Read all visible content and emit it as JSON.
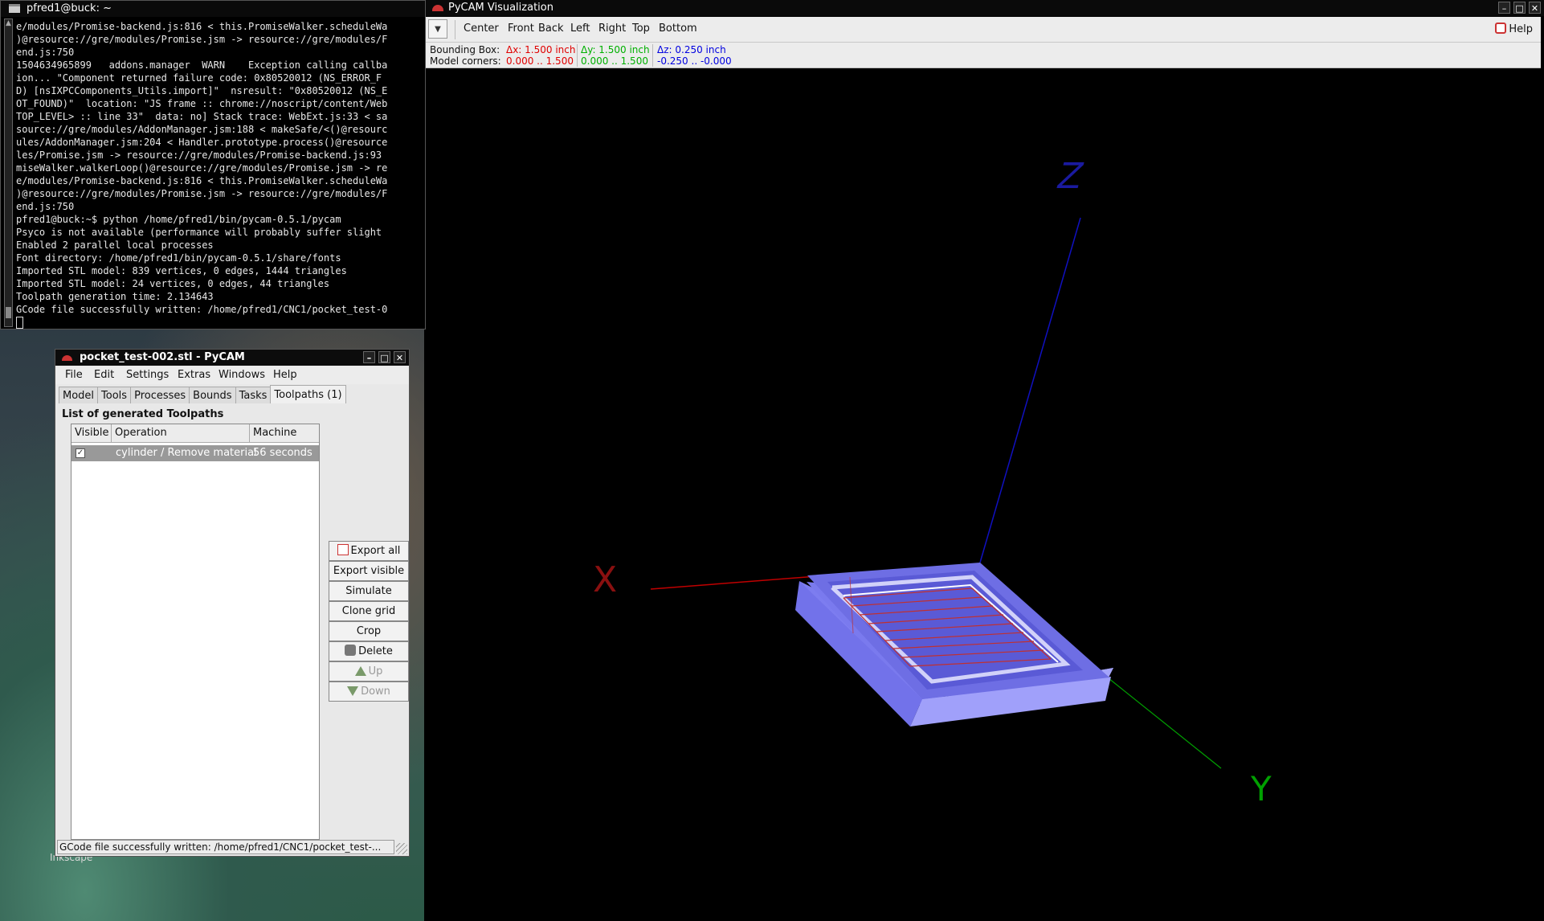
{
  "desktop": {
    "icon_label": "Inkscape"
  },
  "terminal": {
    "title": "pfred1@buck: ~",
    "lines": [
      "e/modules/Promise-backend.js:816 < this.PromiseWalker.scheduleWa",
      ")@resource://gre/modules/Promise.jsm -> resource://gre/modules/F",
      "end.js:750",
      "1504634965899   addons.manager  WARN    Exception calling callba",
      "ion... \"Component returned failure code: 0x80520012 (NS_ERROR_F",
      "D) [nsIXPCComponents_Utils.import]\"  nsresult: \"0x80520012 (NS_E",
      "OT_FOUND)\"  location: \"JS frame :: chrome://noscript/content/Web",
      "TOP_LEVEL> :: line 33\"  data: no] Stack trace: WebExt.js:33 < sa",
      "source://gre/modules/AddonManager.jsm:188 < makeSafe/<()@resourc",
      "ules/AddonManager.jsm:204 < Handler.prototype.process()@resource",
      "les/Promise.jsm -> resource://gre/modules/Promise-backend.js:93",
      "miseWalker.walkerLoop()@resource://gre/modules/Promise.jsm -> re",
      "e/modules/Promise-backend.js:816 < this.PromiseWalker.scheduleWa",
      ")@resource://gre/modules/Promise.jsm -> resource://gre/modules/F",
      "end.js:750",
      "pfred1@buck:~$ python /home/pfred1/bin/pycam-0.5.1/pycam",
      "Psyco is not available (performance will probably suffer slight",
      "Enabled 2 parallel local processes",
      "Font directory: /home/pfred1/bin/pycam-0.5.1/share/fonts",
      "Imported STL model: 839 vertices, 0 edges, 1444 triangles",
      "Imported STL model: 24 vertices, 0 edges, 44 triangles",
      "Toolpath generation time: 2.134643",
      "GCode file successfully written: /home/pfred1/CNC1/pocket_test-0"
    ]
  },
  "viz": {
    "title": "PyCAM Visualization",
    "views": [
      "Center",
      "Front",
      "Back",
      "Left",
      "Right",
      "Top",
      "Bottom"
    ],
    "help_label": "Help",
    "bbox_label": "Bounding Box:",
    "corners_label": "Model corners:",
    "dx": "Δx: 1.500 inch",
    "dy": "Δy: 1.500 inch",
    "dz": "Δz: 0.250 inch",
    "cx": "0.000 .. 1.500",
    "cy": "0.000 .. 1.500",
    "cz": "-0.250 .. -0.000",
    "colors": {
      "x": "#e00000",
      "y": "#00b000",
      "z": "#0000e0",
      "model": "#9a9af8"
    },
    "axis_labels": {
      "x": "X",
      "y": "Y",
      "z": "Z"
    }
  },
  "pycam": {
    "title": "pocket_test-002.stl - PyCAM",
    "menu": [
      "File",
      "Edit",
      "Settings",
      "Extras",
      "Windows",
      "Help"
    ],
    "tabs": [
      "Model",
      "Tools",
      "Processes",
      "Bounds",
      "Tasks",
      "Toolpaths (1)"
    ],
    "list_heading": "List of generated Toolpaths",
    "columns": [
      "Visible",
      "Operation",
      "Machine Time"
    ],
    "rows": [
      {
        "visible": true,
        "operation": "cylinder / Remove material",
        "time": "56 seconds"
      }
    ],
    "buttons": [
      "Export all",
      "Export visible",
      "Simulate",
      "Clone grid",
      "Crop",
      "Delete",
      "Up",
      "Down"
    ],
    "status": "GCode file successfully written: /home/pfred1/CNC1/pocket_test-..."
  }
}
